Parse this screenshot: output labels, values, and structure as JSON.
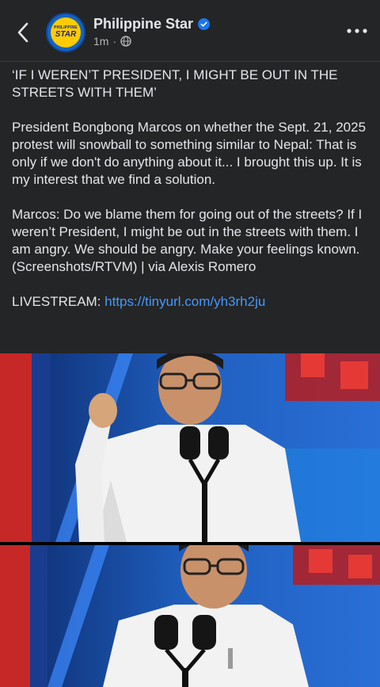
{
  "header": {
    "page_name": "Philippine Star",
    "timestamp": "1m",
    "separator": "·",
    "avatar_text_top": "PHILIPPINE",
    "avatar_text_bottom": "STAR",
    "icons": {
      "back": "chevron-left-icon",
      "verified": "verified-badge-icon",
      "audience": "globe-icon",
      "more": "more-options-icon"
    }
  },
  "post": {
    "headline": "‘IF I WEREN’T PRESIDENT, I MIGHT BE OUT IN THE STREETS WITH THEM’",
    "paragraph1": "President Bongbong Marcos on whether the Sept. 21, 2025 protest will snowball to something similar to Nepal: That is only if we don't do anything about it... I brought this up. It is my interest that we find a solution.",
    "paragraph2": "Marcos: Do we blame them for going out of the streets? If I weren’t President, I might be out in the streets with them. I am angry. We should be angry. Make your feelings known. (Screenshots/RTVM) | via Alexis Romero",
    "livestream_label": "LIVESTREAM:",
    "livestream_link": "https://tinyurl.com/yh3rh2ju"
  },
  "colors": {
    "background": "#242526",
    "text": "#e4e6eb",
    "muted": "#b0b3b8",
    "link": "#4599ff",
    "verified": "#1877f2"
  }
}
